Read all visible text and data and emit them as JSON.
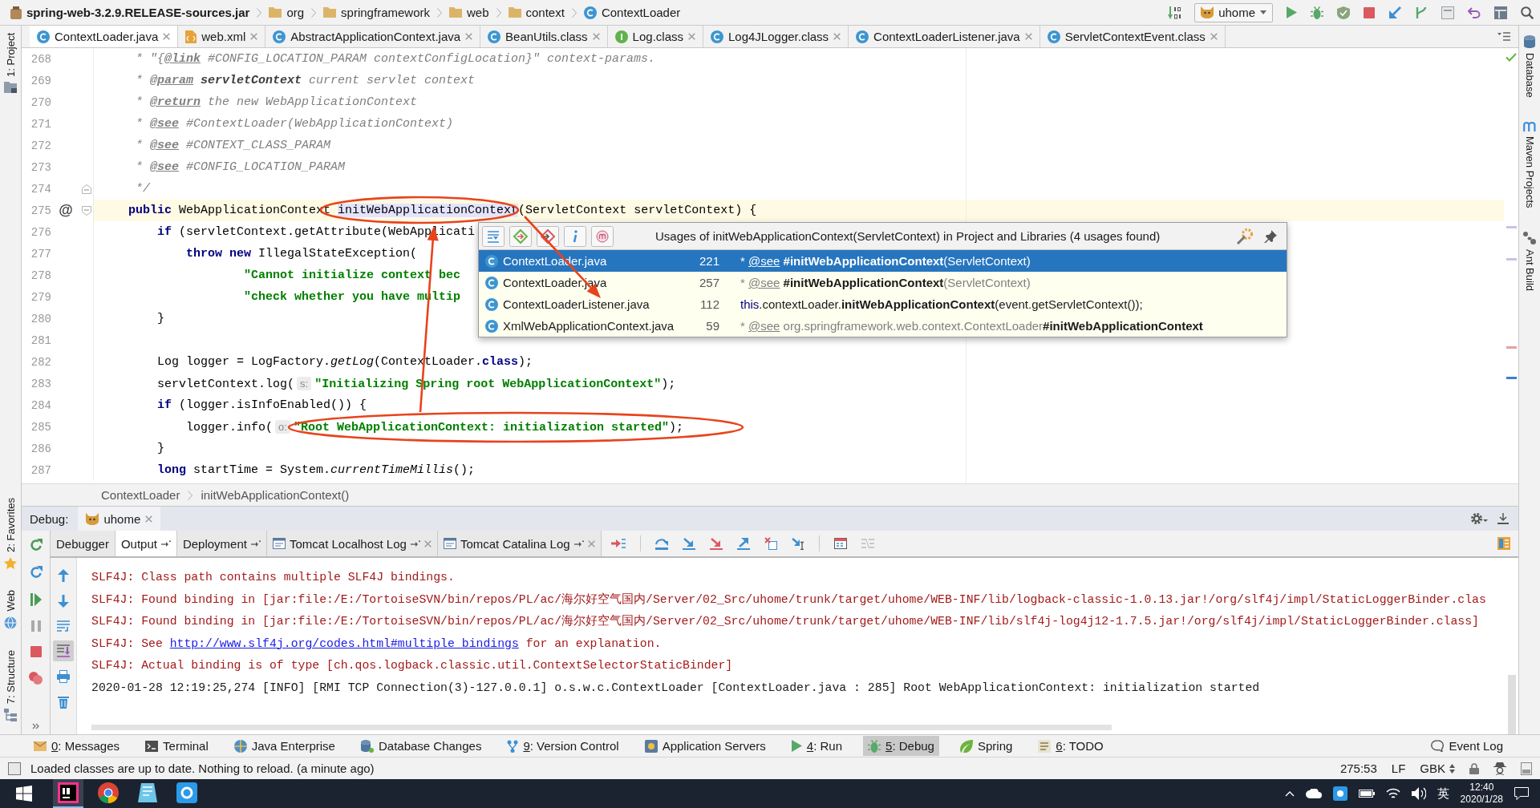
{
  "nav_bar": {
    "crumbs": [
      {
        "label": "spring-web-3.2.9.RELEASE-sources.jar",
        "kind": "jar"
      },
      {
        "label": "org",
        "kind": "package"
      },
      {
        "label": "springframework",
        "kind": "package"
      },
      {
        "label": "web",
        "kind": "package"
      },
      {
        "label": "context",
        "kind": "package"
      },
      {
        "label": "ContextLoader",
        "kind": "class"
      }
    ],
    "run_configuration": "uhome"
  },
  "editor_tabs": [
    {
      "label": "ContextLoader.java",
      "kind": "class",
      "selected": true
    },
    {
      "label": "web.xml",
      "kind": "xml",
      "selected": false
    },
    {
      "label": "AbstractApplicationContext.java",
      "kind": "class",
      "selected": false
    },
    {
      "label": "BeanUtils.class",
      "kind": "class",
      "selected": false
    },
    {
      "label": "Log.class",
      "kind": "interface",
      "selected": false
    },
    {
      "label": "Log4JLogger.class",
      "kind": "class",
      "selected": false
    },
    {
      "label": "ContextLoaderListener.java",
      "kind": "class",
      "selected": false
    },
    {
      "label": "ServletContextEvent.class",
      "kind": "class",
      "selected": false
    }
  ],
  "left_stripe": {
    "top": [
      {
        "label": "1: Project",
        "kind": "project"
      }
    ],
    "bottom": [
      {
        "label": "2: Favorites",
        "kind": "favorites"
      },
      {
        "label": "Web",
        "kind": "web"
      },
      {
        "label": "7: Structure",
        "kind": "structure"
      }
    ]
  },
  "right_stripe": [
    {
      "label": "Database",
      "kind": "database"
    },
    {
      "label": "Maven Projects",
      "kind": "maven"
    },
    {
      "label": "Ant Build",
      "kind": "ant"
    }
  ],
  "editor": {
    "lines": [
      {
        "number": "268",
        "current": false,
        "tokens": [
          {
            "text": "     * \"{",
            "kind": "comment"
          },
          {
            "text": "@link",
            "kind": "doc_tag"
          },
          {
            "text": " #CONFIG_LOCATION_PARAM contextConfigLocation}\" context-params.",
            "kind": "comment"
          }
        ]
      },
      {
        "number": "269",
        "current": false,
        "tokens": [
          {
            "text": "     * ",
            "kind": "comment"
          },
          {
            "text": "@param",
            "kind": "doc_tag"
          },
          {
            "text": " servletContext",
            "kind": "doc_param"
          },
          {
            "text": " current servlet context",
            "kind": "comment"
          }
        ]
      },
      {
        "number": "270",
        "current": false,
        "tokens": [
          {
            "text": "     * ",
            "kind": "comment"
          },
          {
            "text": "@return",
            "kind": "doc_tag"
          },
          {
            "text": " the new WebApplicationContext",
            "kind": "comment"
          }
        ]
      },
      {
        "number": "271",
        "current": false,
        "tokens": [
          {
            "text": "     * ",
            "kind": "comment"
          },
          {
            "text": "@see",
            "kind": "doc_tag"
          },
          {
            "text": " #ContextLoader(WebApplicationContext)",
            "kind": "comment"
          }
        ]
      },
      {
        "number": "272",
        "current": false,
        "tokens": [
          {
            "text": "     * ",
            "kind": "comment"
          },
          {
            "text": "@see",
            "kind": "doc_tag"
          },
          {
            "text": " #CONTEXT_CLASS_PARAM",
            "kind": "comment"
          }
        ]
      },
      {
        "number": "273",
        "current": false,
        "tokens": [
          {
            "text": "     * ",
            "kind": "comment"
          },
          {
            "text": "@see",
            "kind": "doc_tag"
          },
          {
            "text": " #CONFIG_LOCATION_PARAM",
            "kind": "comment"
          }
        ]
      },
      {
        "number": "274",
        "current": false,
        "fold": {
          "kind": "end"
        },
        "tokens": [
          {
            "text": "     */",
            "kind": "comment"
          }
        ]
      },
      {
        "number": "275",
        "current": true,
        "gutter": "@",
        "fold": {
          "kind": "start"
        },
        "tokens": [
          {
            "text": "    public",
            "kind": "keyword"
          },
          {
            "text": " WebApplicationContext ",
            "kind": "plain"
          },
          {
            "text": "initWebApplicationContext",
            "kind": "usage"
          },
          {
            "text": "(ServletContext servletContext) {",
            "kind": "plain"
          }
        ]
      },
      {
        "number": "276",
        "current": false,
        "tokens": [
          {
            "text": "        if",
            "kind": "keyword"
          },
          {
            "text": " (servletContext.getAttribute(WebApplicati",
            "kind": "plain"
          }
        ]
      },
      {
        "number": "277",
        "current": false,
        "tokens": [
          {
            "text": "            throw",
            "kind": "keyword"
          },
          {
            "text": " new",
            "kind": "keyword"
          },
          {
            "text": " IllegalStateException(",
            "kind": "plain"
          }
        ]
      },
      {
        "number": "278",
        "current": false,
        "tokens": [
          {
            "text": "                    \"Cannot initialize context bec",
            "kind": "string"
          }
        ]
      },
      {
        "number": "279",
        "current": false,
        "tokens": [
          {
            "text": "                    \"check whether you have multip",
            "kind": "string"
          }
        ]
      },
      {
        "number": "280",
        "current": false,
        "tokens": [
          {
            "text": "        }",
            "kind": "plain"
          }
        ]
      },
      {
        "number": "281",
        "current": false
      },
      {
        "number": "282",
        "current": false,
        "tokens": [
          {
            "text": "        Log logger = LogFactory.",
            "kind": "plain"
          },
          {
            "text": "getLog",
            "kind": "italic"
          },
          {
            "text": "(ContextLoader.",
            "kind": "plain"
          },
          {
            "text": "class",
            "kind": "keyword"
          },
          {
            "text": ");",
            "kind": "plain"
          }
        ]
      },
      {
        "number": "283",
        "current": false,
        "tokens": [
          {
            "text": "        servletContext.log(",
            "kind": "plain"
          },
          {
            "text": "s:",
            "kind": "hint"
          },
          {
            "text": "\"Initializing Spring root WebApplicationContext\"",
            "kind": "string"
          },
          {
            "text": ");",
            "kind": "plain"
          }
        ]
      },
      {
        "number": "284",
        "current": false,
        "tokens": [
          {
            "text": "        if",
            "kind": "keyword"
          },
          {
            "text": " (logger.isInfoEnabled()) {",
            "kind": "plain"
          }
        ]
      },
      {
        "number": "285",
        "current": false,
        "tokens": [
          {
            "text": "            logger.info(",
            "kind": "plain"
          },
          {
            "text": "o:",
            "kind": "hint"
          },
          {
            "text": "\"Root WebApplicationContext: initialization started\"",
            "kind": "string"
          },
          {
            "text": ");",
            "kind": "plain"
          }
        ]
      },
      {
        "number": "286",
        "current": false,
        "tokens": [
          {
            "text": "        }",
            "kind": "plain"
          }
        ]
      },
      {
        "number": "287",
        "current": false,
        "tokens": [
          {
            "text": "        long",
            "kind": "keyword"
          },
          {
            "text": " startTime = System.",
            "kind": "plain"
          },
          {
            "text": "currentTimeMillis",
            "kind": "italic"
          },
          {
            "text": "();",
            "kind": "plain"
          }
        ]
      }
    ]
  },
  "usages_popup": {
    "title": "Usages of initWebApplicationContext(ServletContext) in Project and Libraries (4 usages found)",
    "usages": [
      {
        "file": "ContextLoader.java",
        "line": "221",
        "selected": true,
        "preview": [
          {
            "text": "* ",
            "kind": "comment"
          },
          {
            "text": "@see",
            "kind": "tag"
          },
          {
            "text": " #initWebApplicationContext",
            "kind": "match"
          },
          {
            "text": "(ServletContext)",
            "kind": "comment"
          }
        ]
      },
      {
        "file": "ContextLoader.java",
        "line": "257",
        "selected": false,
        "preview": [
          {
            "text": "* ",
            "kind": "comment"
          },
          {
            "text": "@see",
            "kind": "tag"
          },
          {
            "text": " #initWebApplicationContext",
            "kind": "match"
          },
          {
            "text": "(ServletContext)",
            "kind": "comment"
          }
        ]
      },
      {
        "file": "ContextLoaderListener.java",
        "line": "112",
        "selected": false,
        "preview": [
          {
            "text": "this",
            "kind": "keyword"
          },
          {
            "text": ".contextLoader.",
            "kind": "code"
          },
          {
            "text": "initWebApplicationContext",
            "kind": "match"
          },
          {
            "text": "(event.getServletContext());",
            "kind": "code"
          }
        ]
      },
      {
        "file": "XmlWebApplicationContext.java",
        "line": "59",
        "selected": false,
        "preview": [
          {
            "text": "* ",
            "kind": "comment"
          },
          {
            "text": "@see",
            "kind": "tag"
          },
          {
            "text": " org.springframework.web.context.ContextLoader",
            "kind": "comment"
          },
          {
            "text": "#initWebApplicationContext",
            "kind": "match"
          }
        ]
      }
    ]
  },
  "editor_breadcrumbs": [
    "ContextLoader",
    "initWebApplicationContext()"
  ],
  "debug": {
    "title": "Debug:",
    "sessions": [
      {
        "label": "uhome",
        "selected": true
      }
    ],
    "tabs": [
      {
        "label": "Debugger",
        "kind": "view",
        "selected": false
      },
      {
        "label": "Output",
        "kind": "console",
        "selected": true
      },
      {
        "label": "Deployment",
        "kind": "console",
        "selected": false
      },
      {
        "label": "Tomcat Localhost Log",
        "kind": "log",
        "selected": false
      },
      {
        "label": "Tomcat Catalina Log",
        "kind": "log",
        "selected": false
      }
    ],
    "soft_wrap": false,
    "scroll_to_end": true,
    "console": [
      {
        "kind": "stderr",
        "parts": [
          {
            "text": "SLF4J: Class path contains multiple SLF4J bindings.",
            "kind": "text"
          }
        ]
      },
      {
        "kind": "stderr",
        "parts": [
          {
            "text": "SLF4J: Found binding in [jar:file:/E:/TortoiseSVN/bin/repos/PL/ac/海尔好空气国内/Server/02_Src/uhome/trunk/target/uhome/WEB-INF/lib/logback-classic-1.0.13.jar!/org/slf4j/impl/StaticLoggerBinder.clas",
            "kind": "text"
          }
        ]
      },
      {
        "kind": "stderr",
        "parts": [
          {
            "text": "SLF4J: Found binding in [jar:file:/E:/TortoiseSVN/bin/repos/PL/ac/海尔好空气国内/Server/02_Src/uhome/trunk/target/uhome/WEB-INF/lib/slf4j-log4j12-1.7.5.jar!/org/slf4j/impl/StaticLoggerBinder.class]",
            "kind": "text"
          }
        ]
      },
      {
        "kind": "stderr",
        "parts": [
          {
            "text": "SLF4J: See ",
            "kind": "text"
          },
          {
            "text": "http://www.slf4j.org/codes.html#multiple_bindings",
            "kind": "link"
          },
          {
            "text": " for an explanation.",
            "kind": "text"
          }
        ]
      },
      {
        "kind": "stderr",
        "parts": [
          {
            "text": "SLF4J: Actual binding is of type [ch.qos.logback.classic.util.ContextSelectorStaticBinder]",
            "kind": "text"
          }
        ]
      },
      {
        "kind": "stdout",
        "parts": [
          {
            "text": "2020-01-28 12:19:25,274 [INFO] [RMI TCP Connection(3)-127.0.0.1] o.s.w.c.ContextLoader [ContextLoader.java : 285] Root WebApplicationContext: initialization started",
            "kind": "text"
          }
        ]
      }
    ]
  },
  "tool_window_bar": {
    "items": [
      {
        "label": "0: Messages",
        "kind": "messages",
        "mnemonic": true,
        "selected": false
      },
      {
        "label": "Terminal",
        "kind": "terminal",
        "mnemonic": false,
        "selected": false
      },
      {
        "label": "Java Enterprise",
        "kind": "javaee",
        "mnemonic": false,
        "selected": false
      },
      {
        "label": "Database Changes",
        "kind": "db_changes",
        "mnemonic": false,
        "selected": false
      },
      {
        "label": "9: Version Control",
        "kind": "vcs",
        "mnemonic": true,
        "selected": false
      },
      {
        "label": "Application Servers",
        "kind": "servers",
        "mnemonic": false,
        "selected": false
      },
      {
        "label": "4: Run",
        "kind": "run",
        "mnemonic": true,
        "selected": false
      },
      {
        "label": "5: Debug",
        "kind": "debug",
        "mnemonic": true,
        "selected": true
      },
      {
        "label": "Spring",
        "kind": "spring",
        "mnemonic": false,
        "selected": false
      },
      {
        "label": "6: TODO",
        "kind": "todo",
        "mnemonic": true,
        "selected": false
      }
    ],
    "event_log": "Event Log"
  },
  "status_bar": {
    "message": "Loaded classes are up to date. Nothing to reload. (a minute ago)",
    "position": "275:53",
    "line_separator": "LF",
    "encoding": "GBK"
  },
  "taskbar": {
    "apps": [
      {
        "kind": "ide",
        "selected": true
      },
      {
        "kind": "browser",
        "selected": false
      },
      {
        "kind": "document",
        "selected": false
      },
      {
        "kind": "tool",
        "selected": false
      }
    ],
    "input_language": "英",
    "time": "12:40",
    "date": "2020/1/28"
  }
}
